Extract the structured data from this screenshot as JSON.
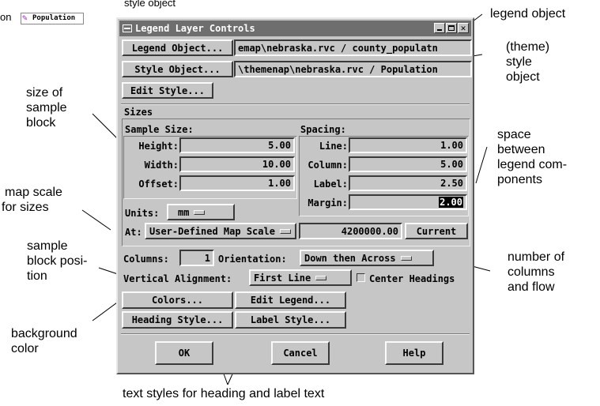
{
  "window": {
    "title": "Legend Layer Controls"
  },
  "top_partial": {
    "left_text": "on",
    "icon_label": "Population",
    "cutoff_text": "style object"
  },
  "buttons": {
    "legend_object": "Legend Object...",
    "style_object": "Style Object...",
    "edit_style": "Edit Style...",
    "current": "Current",
    "colors": "Colors...",
    "edit_legend": "Edit Legend...",
    "heading_style": "Heading Style...",
    "label_style": "Label Style...",
    "ok": "OK",
    "cancel": "Cancel",
    "help": "Help"
  },
  "fields": {
    "legend_object_path": "emap\\nebraska.rvc / county_populatn",
    "style_object_path": "\\themenap\\nebraska.rvc / Population"
  },
  "sizes": {
    "group_label": "Sizes",
    "sample_size_label": "Sample Size:",
    "height_label": "Height:",
    "height_value": "5.00",
    "width_label": "Width:",
    "width_value": "10.00",
    "offset_label": "Offset:",
    "offset_value": "1.00",
    "spacing_label": "Spacing:",
    "line_label": "Line:",
    "line_value": "1.00",
    "column_label": "Column:",
    "column_value": "5.00",
    "label_label": "Label:",
    "label_value": "2.50",
    "margin_label": "Margin:",
    "margin_value": "2.00",
    "units_label": "Units:",
    "units_value": "mm",
    "at_label": "At:",
    "at_value": "User-Defined Map Scale",
    "scale_value": "4200000.00"
  },
  "layout": {
    "columns_label": "Columns:",
    "columns_value": "1",
    "orientation_label": "Orientation:",
    "orientation_value": "Down then Across",
    "valign_label": "Vertical Alignment:",
    "valign_value": "First Line",
    "center_headings_label": "Center Headings",
    "center_headings_checked": false
  },
  "annotations": {
    "legend_object": "legend object",
    "style_object_1": "(theme)",
    "style_object_2": "style",
    "style_object_3": "object",
    "sample_size_1": "size of",
    "sample_size_2": "sample",
    "sample_size_3": "block",
    "map_scale_1": "map scale",
    "map_scale_2": "for sizes",
    "block_pos_1": "sample",
    "block_pos_2": "block posi-",
    "block_pos_3": "tion",
    "background_1": "background",
    "background_2": "color",
    "space_1": "space",
    "space_2": "between",
    "space_3": "legend com-",
    "space_4": "ponents",
    "columns_1": "number of",
    "columns_2": "columns",
    "columns_3": "and flow",
    "text_styles": "text styles for heading and label text"
  }
}
